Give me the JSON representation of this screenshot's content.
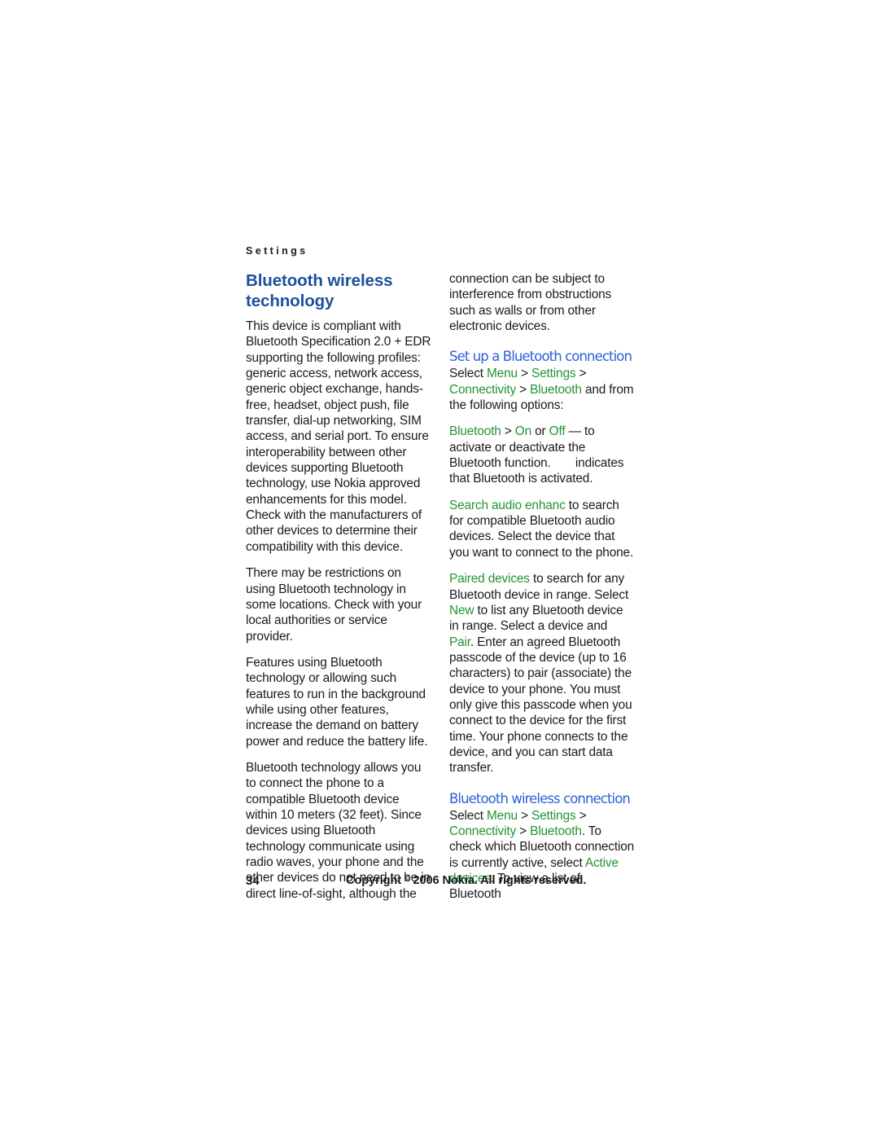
{
  "running_head": "Settings",
  "colors": {
    "heading_blue": "#1d4f9e",
    "subhead_blue": "#2b5fd9",
    "ui_term_green": "#229432",
    "body_text": "#1a1a1a",
    "page_background": "#ffffff"
  },
  "left_column": {
    "title": "Bluetooth wireless technology",
    "paragraphs": [
      "This device is compliant with Bluetooth Specification 2.0 + EDR supporting the following profiles: generic access, network access, generic object exchange, hands-free, headset, object push, file transfer, dial-up networking, SIM access, and serial port. To ensure interoperability between other devices supporting Bluetooth technology, use Nokia approved enhancements for this model. Check with the manufacturers of other devices to determine their compatibility with this device.",
      "There may be restrictions on using Bluetooth technology in some locations. Check with your local authorities or service provider.",
      "Features using Bluetooth technology or allowing such features to run in the background while using other features, increase the demand on battery power and reduce the battery life.",
      "Bluetooth technology allows you to connect the phone to a compatible Bluetooth device within 10 meters (32 feet). Since devices using Bluetooth technology communicate using radio waves, your phone and the other devices do not need to be in direct line-of-sight, although the"
    ]
  },
  "right_column": {
    "continued_paragraph": "connection can be subject to interference from obstructions such as walls or from other electronic devices.",
    "section_setup": {
      "heading": "Set up a Bluetooth connection",
      "intro_prefix": "Select ",
      "menu": "Menu",
      "sep1": " > ",
      "settings": "Settings",
      "sep2": " > ",
      "connectivity": "Connectivity",
      "sep3": " > ",
      "bluetooth": "Bluetooth",
      "intro_suffix": " and from the following options:",
      "option_bluetooth": {
        "term": "Bluetooth",
        "sep": " > ",
        "on": "On",
        "mid": " or ",
        "off": "Off",
        "text_before_icon": " — to activate or deactivate the Bluetooth function. ",
        "text_after_icon": " indicates that Bluetooth is activated."
      },
      "option_search": {
        "term": "Search audio enhanc",
        "text": " to search for compatible Bluetooth audio devices. Select the device that you want to connect to the phone."
      },
      "option_paired": {
        "term": "Paired devices",
        "text_1": " to search for any Bluetooth device in range. Select ",
        "term_new": "New",
        "text_2": " to list any Bluetooth device in range. Select a device and ",
        "term_pair": "Pair",
        "text_3": ". Enter an agreed Bluetooth passcode of the device (up to 16 characters) to pair (associate) the device to your phone. You must only give this passcode when you connect to the device for the first time. Your phone connects to the device, and you can start data transfer."
      }
    },
    "section_connection": {
      "heading": "Bluetooth wireless connection",
      "intro_prefix": "Select ",
      "menu": "Menu",
      "sep1": " > ",
      "settings": "Settings",
      "sep2": " > ",
      "connectivity": "Connectivity",
      "sep3": " > ",
      "bluetooth": "Bluetooth",
      "text_1": ". To check which Bluetooth connection is currently active, select ",
      "term_active": "Active devices",
      "text_2": ". To view a list of Bluetooth"
    }
  },
  "footer": {
    "page_number": "34",
    "copyright_before": "Copyright ",
    "copyright_symbol": "©",
    "copyright_after": " 2006 Nokia. All rights reserved."
  }
}
